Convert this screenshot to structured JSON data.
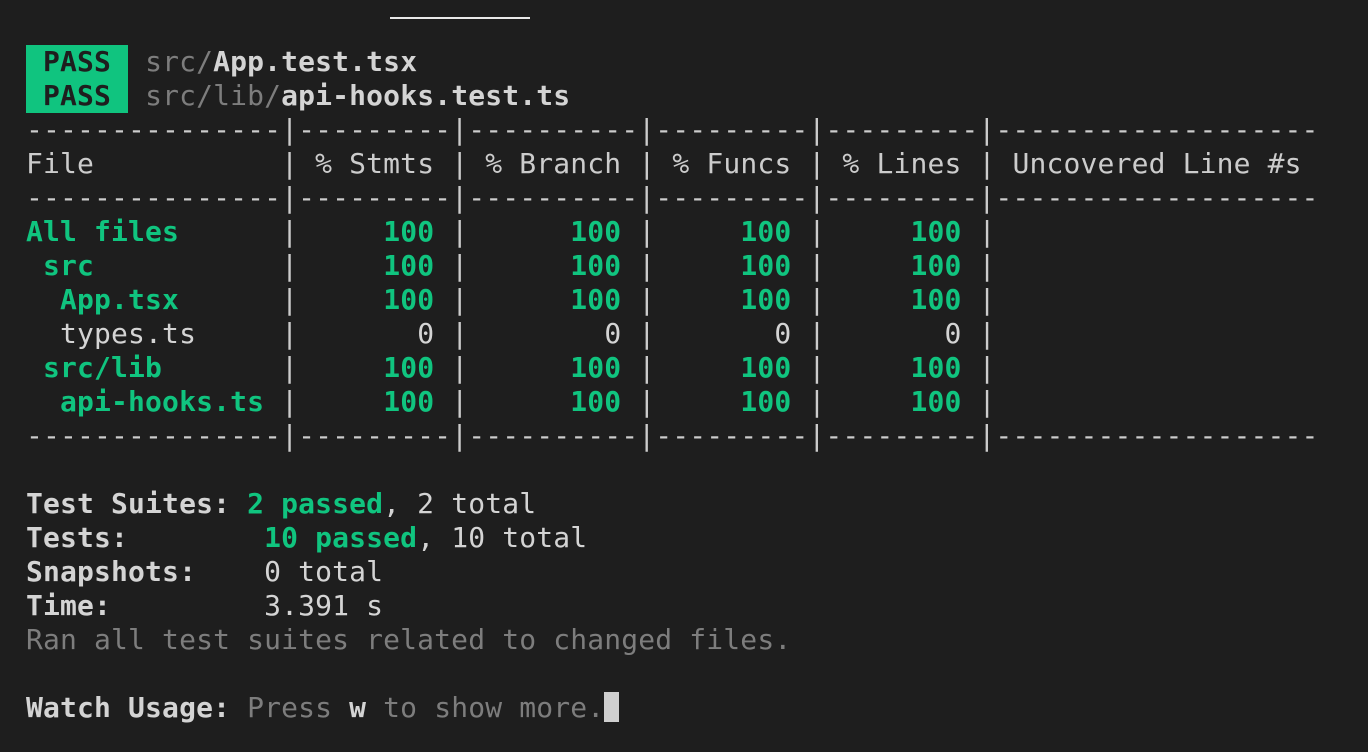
{
  "results": [
    {
      "status": "PASS",
      "path_dir": "src/",
      "path_file": "App.test.tsx"
    },
    {
      "status": "PASS",
      "path_dir": "src/lib/",
      "path_file": "api-hooks.test.ts"
    }
  ],
  "coverage": {
    "separator": "---------------|---------|----------|---------|---------|-------------------",
    "headers": [
      "File",
      "% Stmts",
      "% Branch",
      "% Funcs",
      "% Lines",
      "Uncovered Line #s"
    ],
    "rows": [
      {
        "file": "All files",
        "indent": 0,
        "stmts": "100",
        "branch": "100",
        "funcs": "100",
        "lines": "100",
        "uncovered": "",
        "covered": true
      },
      {
        "file": "src",
        "indent": 1,
        "stmts": "100",
        "branch": "100",
        "funcs": "100",
        "lines": "100",
        "uncovered": "",
        "covered": true
      },
      {
        "file": "App.tsx",
        "indent": 2,
        "stmts": "100",
        "branch": "100",
        "funcs": "100",
        "lines": "100",
        "uncovered": "",
        "covered": true
      },
      {
        "file": "types.ts",
        "indent": 2,
        "stmts": "0",
        "branch": "0",
        "funcs": "0",
        "lines": "0",
        "uncovered": "",
        "covered": false
      },
      {
        "file": "src/lib",
        "indent": 1,
        "stmts": "100",
        "branch": "100",
        "funcs": "100",
        "lines": "100",
        "uncovered": "",
        "covered": true
      },
      {
        "file": "api-hooks.ts",
        "indent": 2,
        "stmts": "100",
        "branch": "100",
        "funcs": "100",
        "lines": "100",
        "uncovered": "",
        "covered": true
      }
    ]
  },
  "summary": {
    "suites_label": "Test Suites:",
    "suites_passed": "2 passed",
    "suites_total": ", 2 total",
    "tests_label": "Tests:",
    "tests_passed": "10 passed",
    "tests_total": ", 10 total",
    "snapshots_label": "Snapshots:",
    "snapshots_value": "0 total",
    "time_label": "Time:",
    "time_value": "3.391 s",
    "ran_message": "Ran all test suites related to changed files."
  },
  "watch": {
    "label": "Watch Usage:",
    "press": " Press ",
    "key": "w",
    "rest": " to show more."
  },
  "colors": {
    "pass": "#10c47f",
    "background": "#1e1e1e",
    "text": "#cccccc",
    "dim": "#7d7d7d"
  }
}
